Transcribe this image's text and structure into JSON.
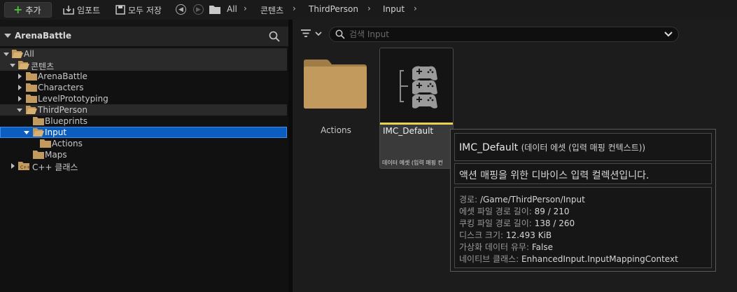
{
  "toolbar": {
    "add_label": "추가",
    "import_label": "임포트",
    "save_all_label": "모두 저장",
    "breadcrumb": [
      "All",
      "콘텐츠",
      "ThirdPerson",
      "Input"
    ]
  },
  "sidebar": {
    "title": "ArenaBattle",
    "tree": [
      {
        "label": "All"
      },
      {
        "label": "콘텐츠"
      },
      {
        "label": "ArenaBattle"
      },
      {
        "label": "Characters"
      },
      {
        "label": "LevelPrototyping"
      },
      {
        "label": "ThirdPerson"
      },
      {
        "label": "Blueprints"
      },
      {
        "label": "Input"
      },
      {
        "label": "Actions"
      },
      {
        "label": "Maps"
      },
      {
        "label": "C++ 클래스"
      }
    ]
  },
  "content": {
    "search_placeholder": "검색 Input",
    "folder_label": "Actions",
    "asset": {
      "name": "IMC_Default",
      "type_short": "데이터 에셋 (입력 매핑 컨"
    }
  },
  "tooltip": {
    "name": "IMC_Default",
    "type": "(데이터 에셋 (입력 매핑 컨텍스트))",
    "description": "액션 매핑을 위한 디바이스 입력 컬렉션입니다.",
    "props": [
      {
        "key": "경로:",
        "value": "/Game/ThirdPerson/Input"
      },
      {
        "key": "에셋 파일 경로 길이:",
        "value": "89 / 210"
      },
      {
        "key": "쿠킹 파일 경로 길이:",
        "value": "138 / 260"
      },
      {
        "key": "디스크 크기:",
        "value": "12.493 KiB"
      },
      {
        "key": "가상화 데이터 유무:",
        "value": "False"
      },
      {
        "key": "네이티브 클래스:",
        "value": "EnhancedInput.InputMappingContext"
      }
    ]
  },
  "colors": {
    "accent_green": "#4fbf3a",
    "selection_blue": "#0b5dbf",
    "folder_tan": "#c39a5e",
    "asset_strip_yellow": "#e8d34a"
  }
}
